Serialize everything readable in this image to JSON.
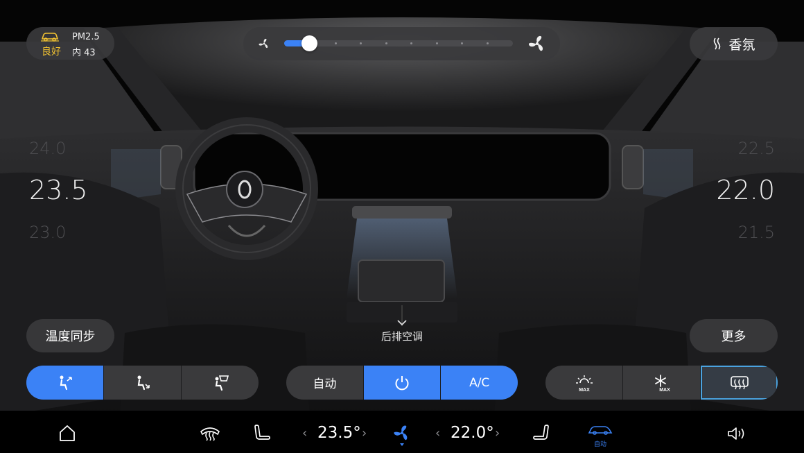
{
  "colors": {
    "accent": "#3b82f6",
    "air_quality_good": "#f1c232",
    "panel": "#3a3a3c"
  },
  "air_quality": {
    "quality_label": "良好",
    "pm_label": "PM2.5",
    "inside_label": "内 43",
    "icon": "car-air-icon"
  },
  "fan": {
    "level_fraction": 0.11,
    "min_icon": "fan-small-icon",
    "max_icon": "fan-large-icon"
  },
  "fragrance": {
    "label": "香氛",
    "icon": "fragrance-icon"
  },
  "left_zone": {
    "temp_above": "24.0",
    "temp_current": "23.5",
    "temp_below": "23.0"
  },
  "right_zone": {
    "temp_above": "22.5",
    "temp_current": "22.0",
    "temp_below": "21.5"
  },
  "sync_button": {
    "label": "温度同步"
  },
  "more_button": {
    "label": "更多"
  },
  "rear_ac": {
    "label": "后排空调",
    "icon": "chevron-down-icon"
  },
  "airflow_modes": [
    {
      "icon": "airflow-face-icon",
      "active": true
    },
    {
      "icon": "airflow-feet-icon",
      "active": false
    },
    {
      "icon": "airflow-windshield-icon",
      "active": false
    }
  ],
  "ac_controls": {
    "auto_label": "自动",
    "power_icon": "power-icon",
    "power_on": true,
    "ac_label": "A/C",
    "ac_on": true
  },
  "max_modes": [
    {
      "icon": "max-heat-icon",
      "sub": "MAX",
      "active": false
    },
    {
      "icon": "max-cool-icon",
      "sub": "MAX",
      "active": false
    },
    {
      "icon": "rear-defrost-icon",
      "active": true
    }
  ],
  "bottom_bar": {
    "home_icon": "home-icon",
    "defrost_icon": "front-defrost-icon",
    "left_seat_icon": "seat-left-icon",
    "left_temp": "23.5°",
    "fan_icon": "fan-icon",
    "right_temp": "22.0°",
    "right_seat_icon": "seat-right-icon",
    "auto_car_label": "自动",
    "volume_icon": "volume-icon"
  }
}
